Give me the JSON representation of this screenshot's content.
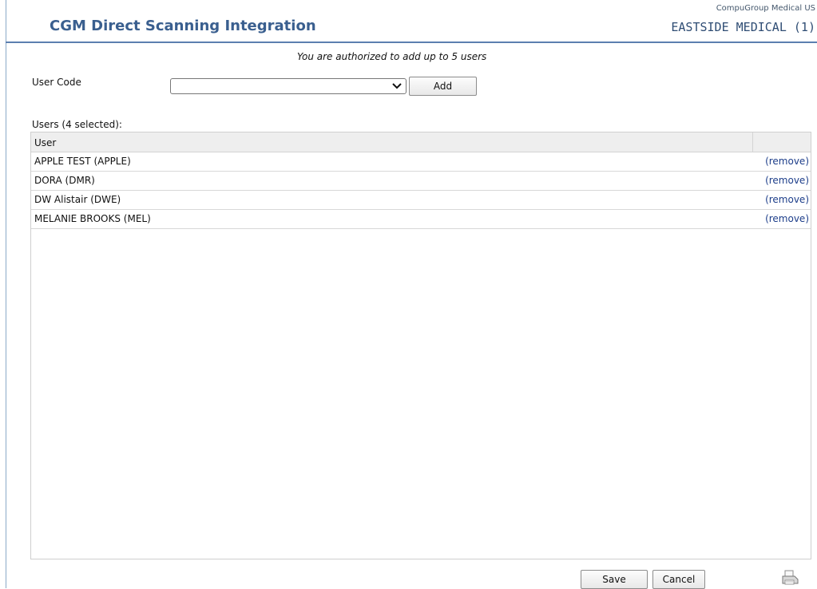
{
  "header": {
    "title": "CGM Direct Scanning Integration",
    "company": "CompuGroup Medical US",
    "practice": "EASTSIDE MEDICAL (1)"
  },
  "authorization": {
    "message": "You are authorized to add up to 5 users"
  },
  "user_code": {
    "label": "User Code",
    "selected_value": "",
    "add_label": "Add"
  },
  "users": {
    "summary": "Users (4 selected):",
    "column_header": "User",
    "rows": [
      {
        "name": "APPLE TEST (APPLE)",
        "action": "(remove)"
      },
      {
        "name": "DORA (DMR)",
        "action": "(remove)"
      },
      {
        "name": "DW Alistair (DWE)",
        "action": "(remove)"
      },
      {
        "name": "MELANIE BROOKS (MEL)",
        "action": "(remove)"
      }
    ]
  },
  "footer": {
    "save_label": "Save",
    "cancel_label": "Cancel",
    "print_icon": "printer-icon"
  },
  "colors": {
    "title": "#3a5f8f",
    "header_line": "#5b7fb0",
    "link": "#1d3e8a"
  }
}
